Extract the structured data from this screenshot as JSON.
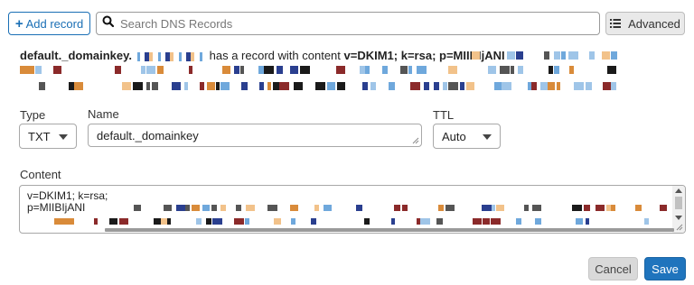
{
  "toolbar": {
    "add_record_label": "Add record",
    "search_placeholder": "Search DNS Records",
    "advanced_label": "Advanced"
  },
  "message": {
    "record_name": "default._domainkey.",
    "middle_text": "has a record with content",
    "content_start": "v=DKIM1; k=rsa; p=MIIBIjANI"
  },
  "form": {
    "type_label": "Type",
    "type_value": "TXT",
    "name_label": "Name",
    "name_value": "default._domainkey",
    "ttl_label": "TTL",
    "ttl_value": "Auto",
    "content_label": "Content",
    "content_line1": "v=DKIM1; k=rsa;",
    "content_line2": "p=MIIBIjANI"
  },
  "actions": {
    "cancel_label": "Cancel",
    "save_label": "Save"
  },
  "colors": {
    "accent": "#1f74bd",
    "redaction_palette": [
      "#1a1a1a",
      "#2a3f8f",
      "#d98b3a",
      "#6fa8dc",
      "#8b2a2a",
      "#f2c28a",
      "#9fc5e8",
      "#555555"
    ]
  }
}
